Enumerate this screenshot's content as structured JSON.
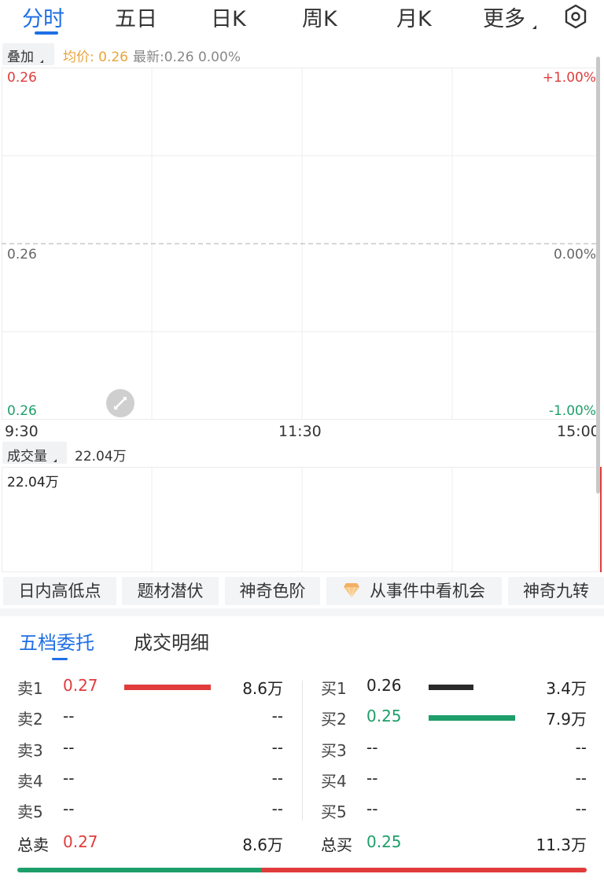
{
  "tabs": [
    {
      "label": "分时",
      "active": true
    },
    {
      "label": "五日"
    },
    {
      "label": "日K"
    },
    {
      "label": "周K"
    },
    {
      "label": "月K"
    },
    {
      "label": "更多"
    }
  ],
  "overlay": {
    "label": "叠加"
  },
  "info": {
    "avg": "均价: 0.26",
    "latest": "最新:0.26 0.00%"
  },
  "main_chart": {
    "price_high": "0.26",
    "price_mid": "0.26",
    "price_low": "0.26",
    "pct_high": "+1.00%",
    "pct_mid": "0.00%",
    "pct_low": "-1.00%"
  },
  "time_axis": {
    "start": "9:30",
    "mid": "11:30",
    "end": "15:00"
  },
  "volume": {
    "label": "成交量",
    "value": "22.04万",
    "axis_max": "22.04万"
  },
  "chips": [
    {
      "label": "日内高低点"
    },
    {
      "label": "题材潜伏"
    },
    {
      "label": "神奇色阶"
    },
    {
      "label": "从事件中看机会",
      "icon": "diamond-icon"
    },
    {
      "label": "神奇九转"
    }
  ],
  "order_tabs": [
    {
      "label": "五档委托",
      "active": true
    },
    {
      "label": "成交明细"
    }
  ],
  "sell": [
    {
      "label": "卖1",
      "price": "0.27",
      "volume": "8.6万",
      "bar_fraction": 1.0
    },
    {
      "label": "卖2",
      "price": "--",
      "volume": "--"
    },
    {
      "label": "卖3",
      "price": "--",
      "volume": "--"
    },
    {
      "label": "卖4",
      "price": "--",
      "volume": "--"
    },
    {
      "label": "卖5",
      "price": "--",
      "volume": "--"
    }
  ],
  "buy": [
    {
      "label": "买1",
      "price": "0.26",
      "volume": "3.4万",
      "bar_fraction": 0.52
    },
    {
      "label": "买2",
      "price": "0.25",
      "volume": "7.9万",
      "bar_fraction": 1.0
    },
    {
      "label": "买3",
      "price": "--",
      "volume": "--"
    },
    {
      "label": "买4",
      "price": "--",
      "volume": "--"
    },
    {
      "label": "买5",
      "price": "--",
      "volume": "--"
    }
  ],
  "totals": {
    "sell_label": "总卖",
    "sell_price": "0.27",
    "sell_volume": "8.6万",
    "buy_label": "总买",
    "buy_price": "0.25",
    "buy_volume": "11.3万"
  },
  "ratio": {
    "buy_fraction": 0.43
  },
  "colors": {
    "accent": "#1f6fe5",
    "up": "#e03c3c",
    "down": "#1e9e6a",
    "avg": "#e8a43a",
    "neutral": "#2a2a2a"
  }
}
